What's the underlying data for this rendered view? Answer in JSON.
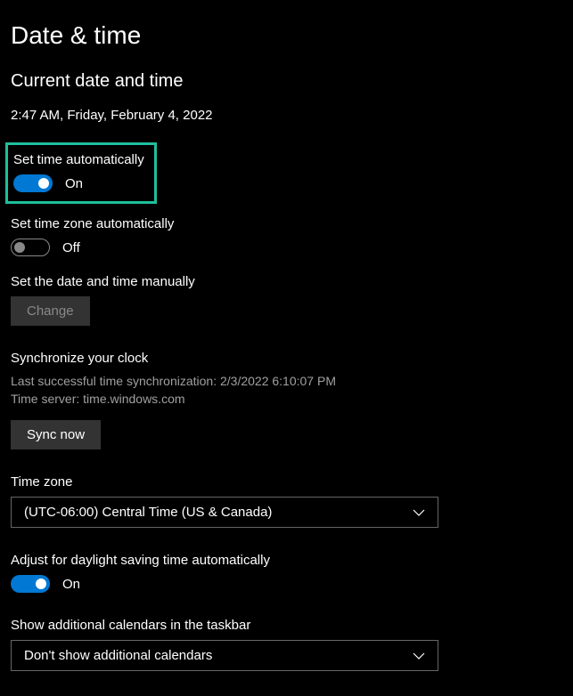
{
  "page": {
    "title": "Date & time"
  },
  "current": {
    "heading": "Current date and time",
    "value": "2:47 AM, Friday, February 4, 2022"
  },
  "autoTime": {
    "label": "Set time automatically",
    "state": "On"
  },
  "autoZone": {
    "label": "Set time zone automatically",
    "state": "Off"
  },
  "manual": {
    "label": "Set the date and time manually",
    "button": "Change"
  },
  "sync": {
    "heading": "Synchronize your clock",
    "lastLine": "Last successful time synchronization: 2/3/2022 6:10:07 PM",
    "serverLine": "Time server: time.windows.com",
    "button": "Sync now"
  },
  "timezone": {
    "label": "Time zone",
    "value": "(UTC-06:00) Central Time (US & Canada)"
  },
  "dst": {
    "label": "Adjust for daylight saving time automatically",
    "state": "On"
  },
  "calendars": {
    "label": "Show additional calendars in the taskbar",
    "value": "Don't show additional calendars"
  }
}
